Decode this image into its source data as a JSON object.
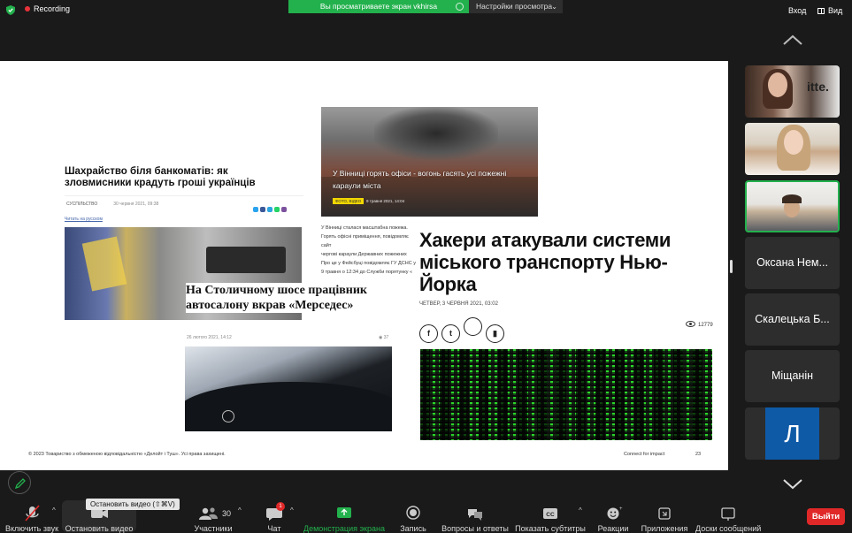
{
  "topbar": {
    "recording_label": "Recording",
    "share_banner": "Вы просматриваете экран vkhirsa",
    "view_settings": "Настройки просмотра",
    "exit_label": "Вход",
    "view_label": "Вид"
  },
  "article1": {
    "title": "Шахрайство біля банкоматів: як зловмисники крадуть гроші українців",
    "category": "СУСПІЛЬСТВО",
    "date": "30 червня 2021, 09:38",
    "ru_link": "Читать на русском"
  },
  "article2": {
    "caption": "У Вінниці горять офіси - вогонь гасять усі пожежні караули міста",
    "badge": "ФОТО, ВІДЕО",
    "date": "9 травня 2021, 14:04",
    "body_lines": [
      "У Вінниці сталася масштабна пожежа. Горять офісні приміщення, повідомляє сайт",
      "чергові караули Державних пожежних",
      "Про це у Фейсбуці повідомляє ГУ ДСНС у",
      "9 травня о 12:34 до Служби порятунку «"
    ]
  },
  "article3": {
    "title": "На Столичному шосе працівник автосалону вкрав «Мерседес»",
    "date": "26 лютого 2021, 14:12",
    "views": "37"
  },
  "article4": {
    "title": "Хакери атакували системи міського транспорту Нью-Йорка",
    "date": "ЧЕТВЕР, 3 ЧЕРВНЯ 2021, 03:02",
    "views": "12779"
  },
  "footer": {
    "copyright": "© 2023 Товариство з обмеженою відповідальністю «Делойт і Туш». Усі права захищені.",
    "tagline": "Connect for impact",
    "page": "23"
  },
  "participants": {
    "tiles": [
      {
        "name": "Оксана Нем..."
      },
      {
        "name": "Скалецька Б..."
      },
      {
        "name": "Міщанін"
      }
    ],
    "avatar_letter": "Л"
  },
  "toolbar": {
    "mute_label": "Включить звук",
    "video_label": "Остановить видео",
    "video_tooltip": "Остановить видео (⇧⌘V)",
    "participants_label": "Участники",
    "participants_count": "30",
    "chat_label": "Чат",
    "chat_badge": "1",
    "share_label": "Демонстрация экрана",
    "record_label": "Запись",
    "qa_label": "Вопросы и ответы",
    "subtitles_label": "Показать субтитры",
    "reactions_label": "Реакции",
    "apps_label": "Приложения",
    "whiteboard_label": "Доски сообщений",
    "leave_label": "Выйти"
  },
  "colors": {
    "share_green": "#23b14d",
    "leave_red": "#e02828",
    "recording_red": "#e8333a"
  }
}
